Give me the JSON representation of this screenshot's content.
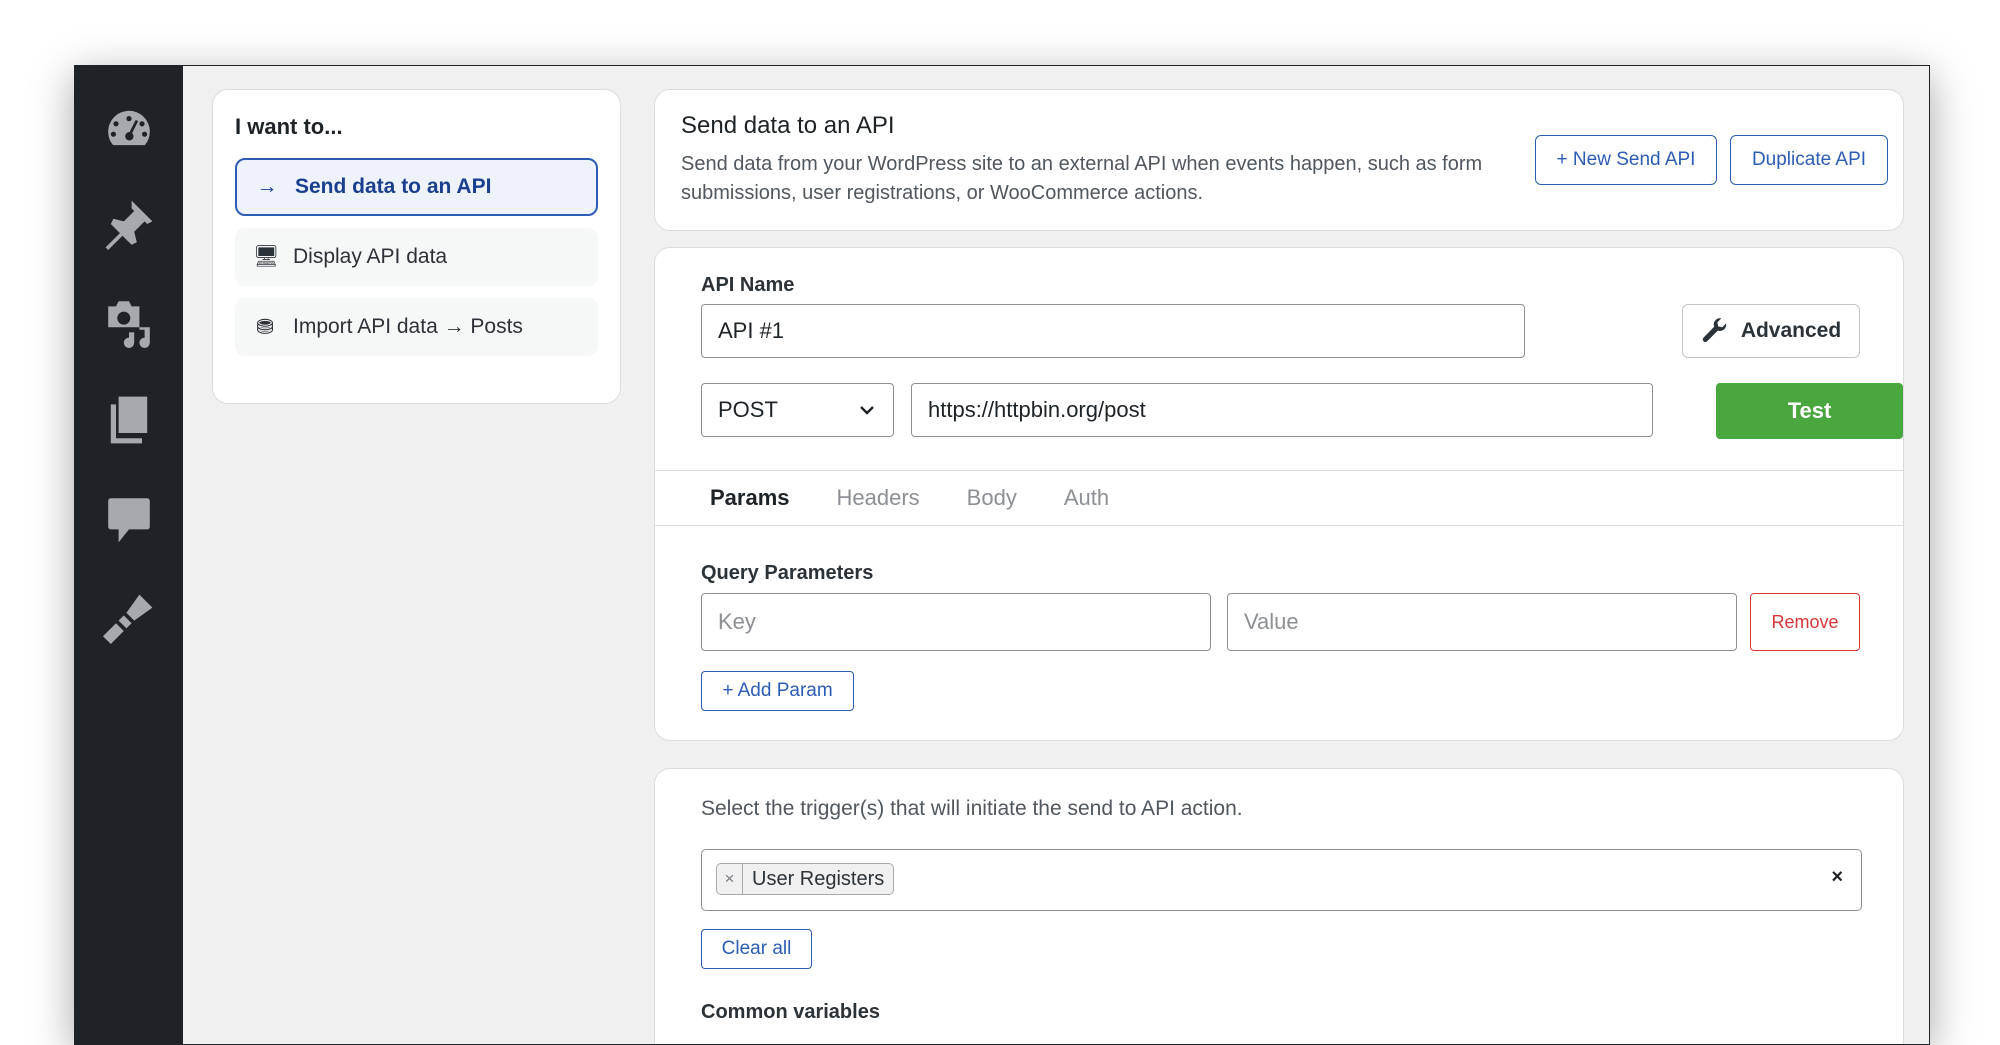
{
  "sidebar": {
    "icons": [
      "dashboard-icon",
      "pin-icon",
      "media-icon",
      "pages-icon",
      "comments-icon",
      "appearance-icon"
    ]
  },
  "intent": {
    "title": "I want to...",
    "items": [
      {
        "icon": "→",
        "label": "Send data to an API"
      },
      {
        "icon": "🖥",
        "label": "Display API data"
      },
      {
        "icon": "⛃",
        "label": "Import API data → Posts"
      }
    ]
  },
  "header": {
    "title": "Send data to an API",
    "description": "Send data from your WordPress site to an external API when events happen, such as form submissions, user registrations, or WooCommerce actions.",
    "new_button": "+ New Send API",
    "duplicate_button": "Duplicate API"
  },
  "config": {
    "api_name_label": "API Name",
    "api_name_value": "API #1",
    "advanced_button": "Advanced",
    "method": "POST",
    "url": "https://httpbin.org/post",
    "test_button": "Test",
    "tabs": [
      "Params",
      "Headers",
      "Body",
      "Auth"
    ],
    "query_label": "Query Parameters",
    "key_placeholder": "Key",
    "value_placeholder": "Value",
    "remove_button": "Remove",
    "add_param_button": "+ Add Param"
  },
  "trigger": {
    "instruction": "Select the trigger(s) that will initiate the send to API action.",
    "selected": "User Registers",
    "chip_remove": "×",
    "clear_icon": "×",
    "clear_all_button": "Clear all",
    "common_variables_label": "Common variables"
  },
  "colors": {
    "accent": "#2c5cb4",
    "success": "#4aa63f",
    "danger": "#d63638",
    "sidebar": "#1d2327"
  }
}
